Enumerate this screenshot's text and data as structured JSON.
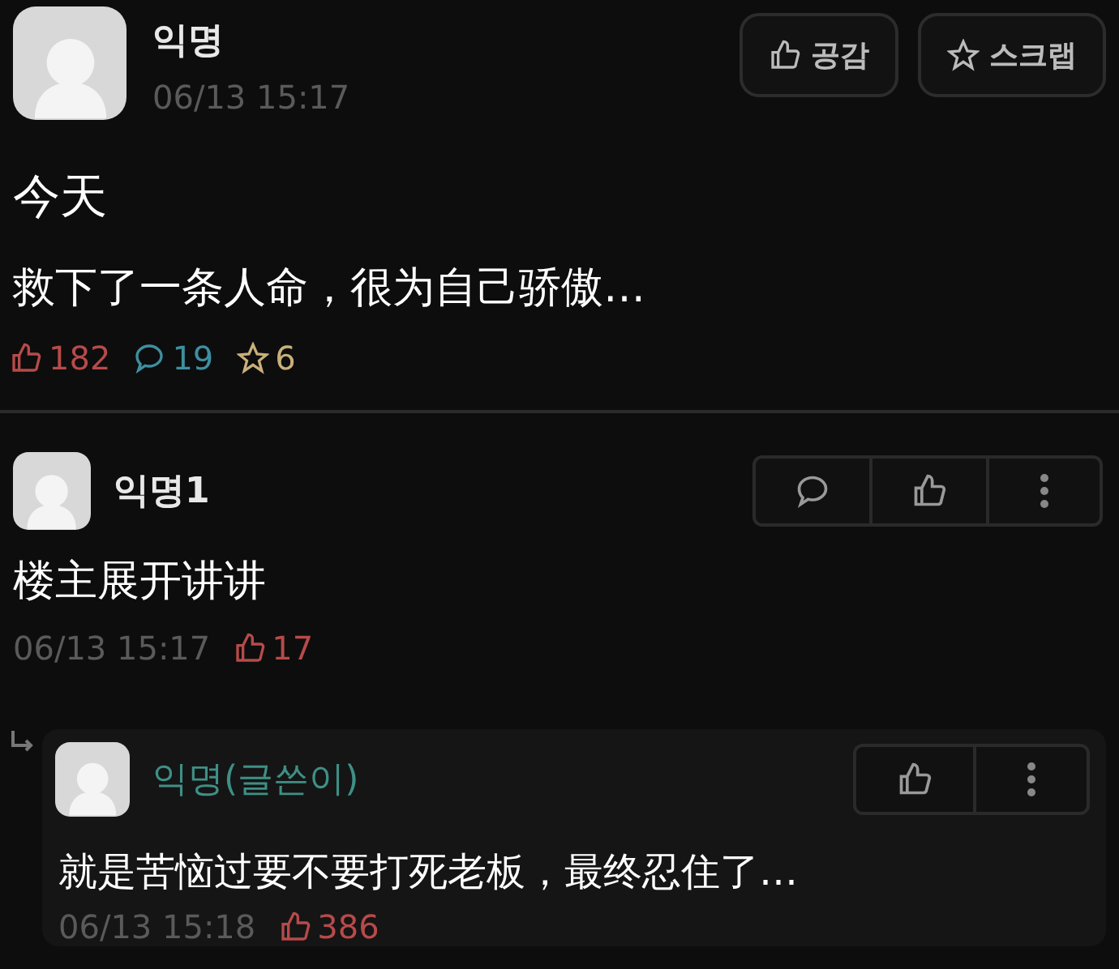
{
  "post": {
    "author": "익명",
    "date": "06/13 15:17",
    "actions": [
      {
        "kind": "like",
        "label": "공감"
      },
      {
        "kind": "scrap",
        "label": "스크랩"
      }
    ],
    "title": "今天",
    "body": "救下了一条人命，很为自己骄傲…",
    "stats": {
      "likes": "182",
      "comments": "19",
      "scraps": "6"
    }
  },
  "comments": [
    {
      "author": "익명1",
      "is_writer": false,
      "text": "楼主展开讲讲",
      "date": "06/13 15:17",
      "likes": "17",
      "children": [
        {
          "author": "익명(글쓴이)",
          "is_writer": true,
          "text": "就是苦恼过要不要打死老板，最终忍住了…",
          "date": "06/13 15:18",
          "likes": "386"
        }
      ]
    }
  ]
}
